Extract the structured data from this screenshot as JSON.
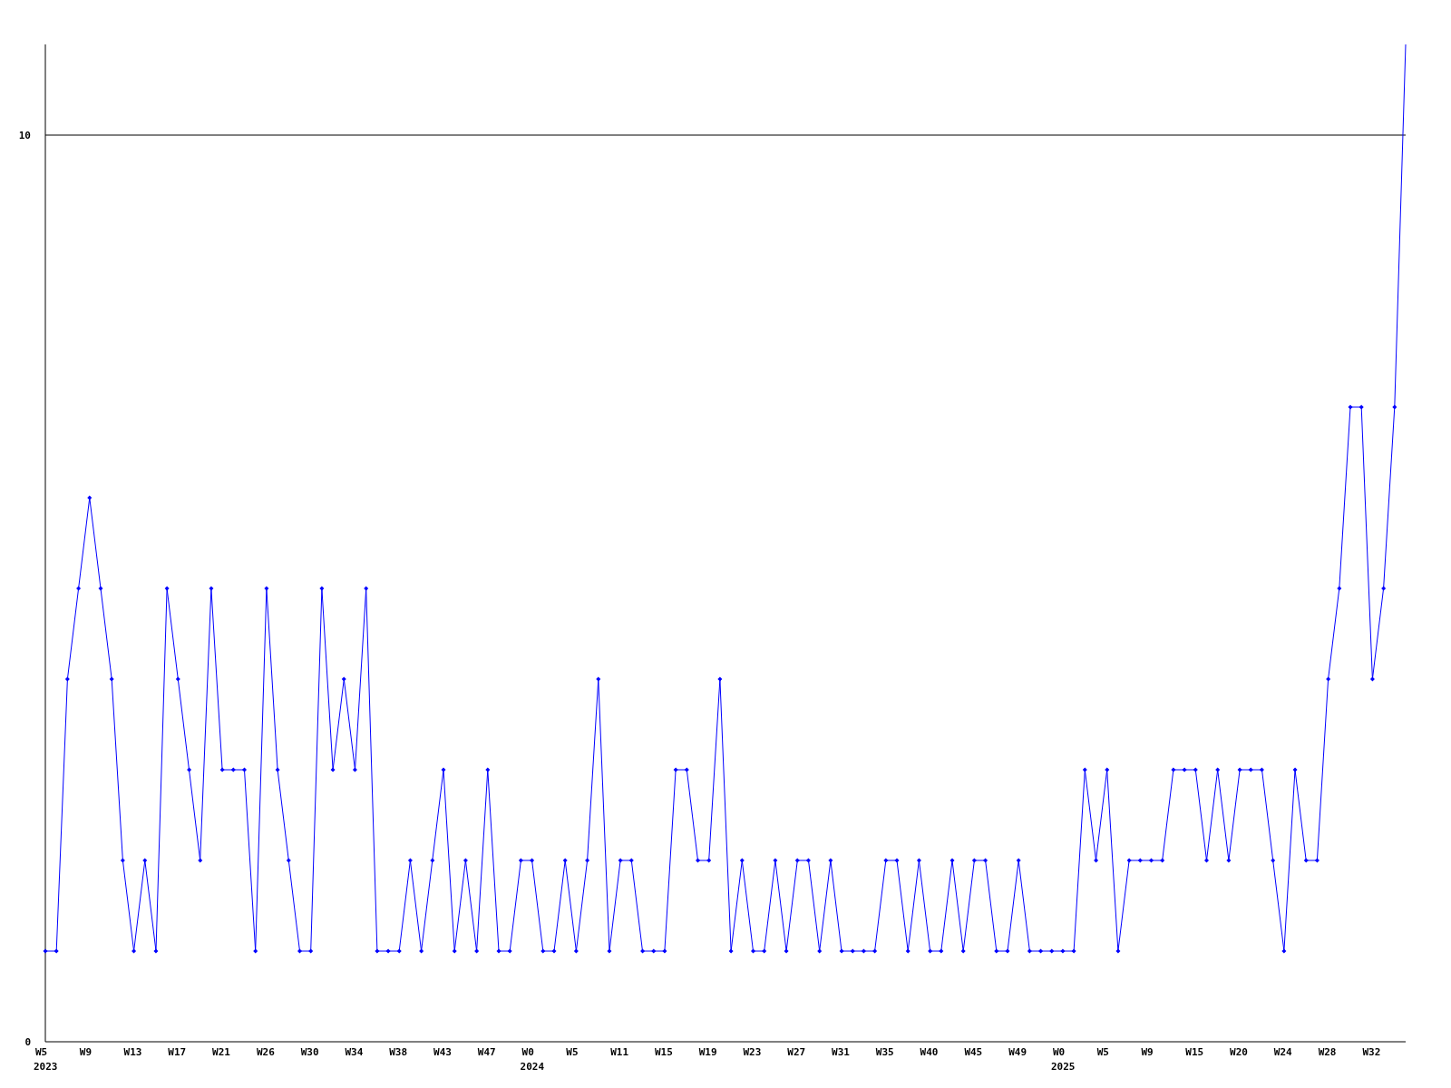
{
  "chart_data": {
    "type": "line",
    "ylim": [
      0,
      11
    ],
    "yticks": [
      0,
      10
    ],
    "categories": [
      "W5\n2023",
      null,
      null,
      null,
      "W9",
      null,
      null,
      null,
      "W13",
      null,
      null,
      null,
      "W17",
      null,
      null,
      null,
      "W21",
      null,
      null,
      null,
      "W26",
      null,
      null,
      null,
      "W30",
      null,
      null,
      null,
      "W34",
      null,
      null,
      null,
      "W38",
      null,
      null,
      null,
      "W43",
      null,
      null,
      null,
      "W47",
      null,
      null,
      null,
      "W0\n2024",
      null,
      null,
      null,
      "W5",
      null,
      null,
      null,
      "W11",
      null,
      null,
      null,
      "W15",
      null,
      null,
      null,
      "W19",
      null,
      null,
      null,
      "W23",
      null,
      null,
      null,
      "W27",
      null,
      null,
      null,
      "W31",
      null,
      null,
      null,
      "W35",
      null,
      null,
      null,
      "W40",
      null,
      null,
      null,
      "W45",
      null,
      null,
      null,
      "W49",
      null,
      null,
      null,
      "W0\n2025",
      null,
      null,
      null,
      "W5",
      null,
      null,
      null,
      "W9",
      null,
      null,
      null,
      "W15",
      null,
      null,
      null,
      "W20",
      null,
      null,
      null,
      "W24",
      null,
      null,
      null,
      "W28",
      null,
      null,
      null,
      "W32",
      null,
      null,
      null
    ],
    "series": [
      {
        "color": "#0000ff",
        "marker": "diamond",
        "values": [
          1,
          1,
          4,
          5,
          6,
          5,
          4,
          2,
          1,
          2,
          1,
          5,
          4,
          3,
          2,
          5,
          3,
          3,
          3,
          1,
          5,
          3,
          2,
          1,
          1,
          5,
          3,
          4,
          3,
          5,
          1,
          1,
          1,
          2,
          1,
          2,
          3,
          1,
          2,
          1,
          3,
          1,
          1,
          2,
          2,
          1,
          1,
          2,
          1,
          2,
          4,
          1,
          2,
          2,
          1,
          1,
          1,
          3,
          3,
          2,
          2,
          4,
          1,
          2,
          1,
          1,
          2,
          1,
          2,
          2,
          1,
          2,
          1,
          1,
          1,
          1,
          2,
          2,
          1,
          2,
          1,
          1,
          2,
          1,
          2,
          2,
          1,
          1,
          2,
          1,
          1,
          1,
          1,
          1,
          3,
          2,
          3,
          1,
          2,
          2,
          2,
          2,
          3,
          3,
          3,
          2,
          3,
          2,
          3,
          3,
          3,
          2,
          1,
          3,
          2,
          2,
          4,
          5,
          7,
          7,
          4,
          5,
          7,
          11
        ]
      }
    ]
  }
}
